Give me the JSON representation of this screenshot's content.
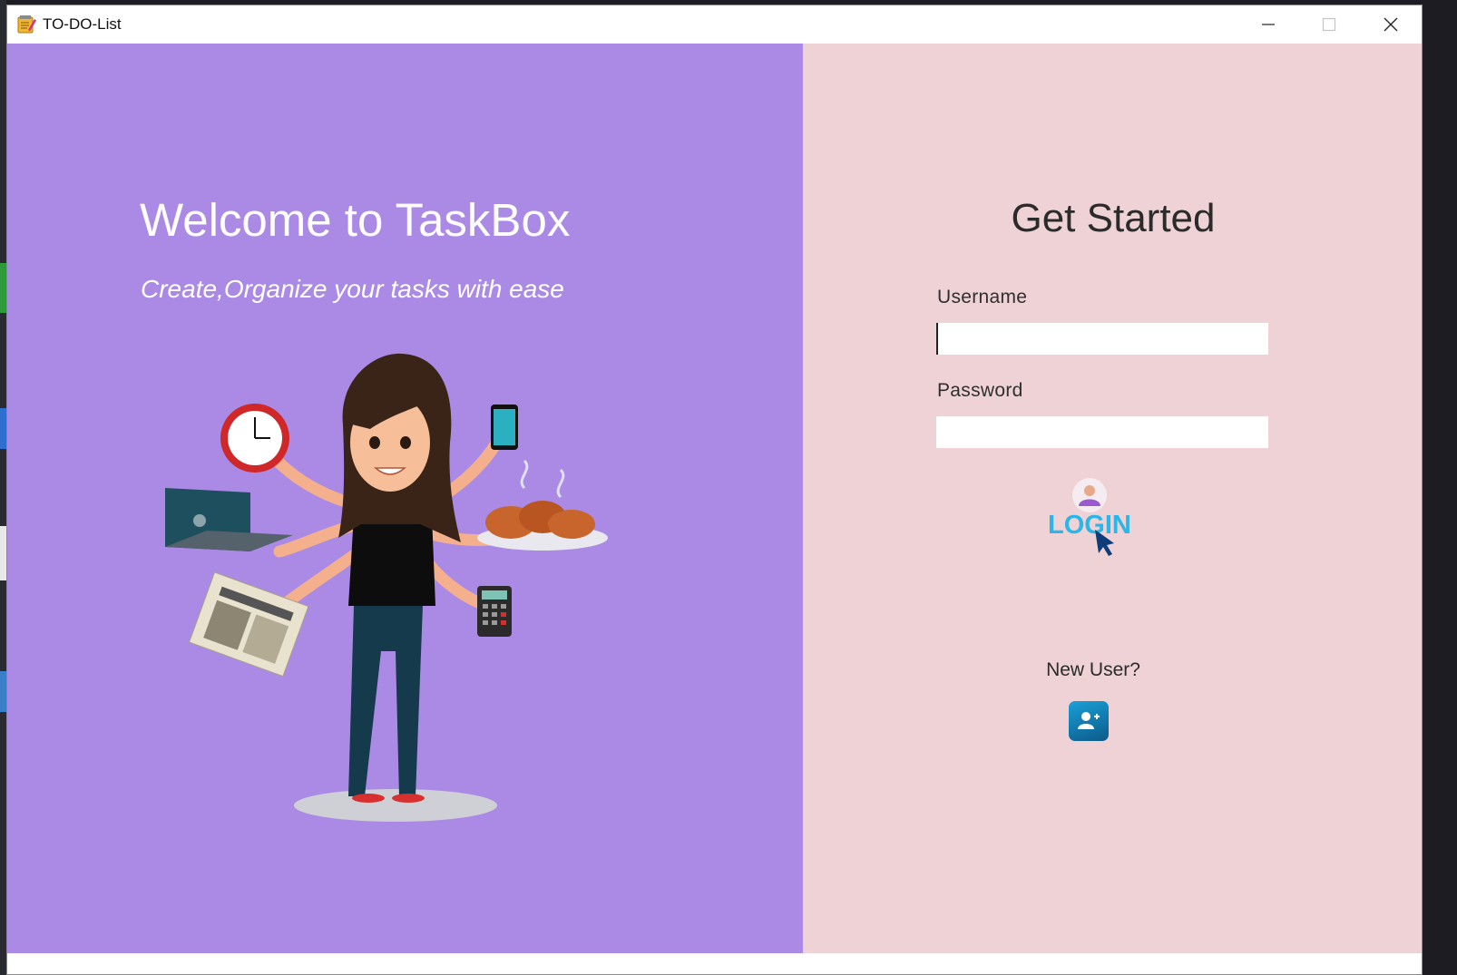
{
  "window": {
    "title": "TO-DO-List",
    "controls": [
      "minimize",
      "maximize",
      "close"
    ]
  },
  "left_panel": {
    "heading": "Welcome to TaskBox",
    "tagline": "Create,Organize your tasks with ease",
    "background": "#ab8ae6",
    "illustration": "multitasking-woman-illustration"
  },
  "right_panel": {
    "heading": "Get Started",
    "background": "#eed2d6",
    "username_label": "Username",
    "username_value": "",
    "password_label": "Password",
    "password_value": "",
    "login_button_text": "LOGIN",
    "new_user_text": "New User?",
    "register_icon": "add-user-icon"
  },
  "colors": {
    "accent_blue": "#1aa0d8",
    "login_text": "#29b6e8"
  }
}
